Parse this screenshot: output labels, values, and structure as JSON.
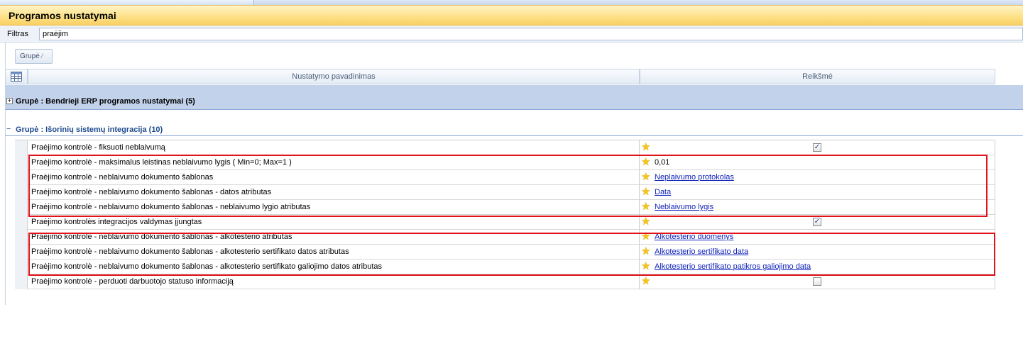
{
  "window": {
    "title": "Programos nustatymai"
  },
  "filter": {
    "label": "Filtras",
    "value": "praėjim"
  },
  "grouping": {
    "button_label": "Grupė",
    "sort_glyph": "⁄"
  },
  "grid": {
    "columns": {
      "name": "Nustatymo pavadinimas",
      "value": "Reikšmė"
    },
    "groups": [
      {
        "expander": "+",
        "label": "Grupė : Bendrieji ERP programos nustatymai (5)",
        "expanded": false
      },
      {
        "expander": "−",
        "label": "Grupė : Išorinių sistemų integracija (10)",
        "expanded": true
      }
    ],
    "rows": [
      {
        "name": "Praėjimo kontrolė - fiksuoti neblaivumą",
        "value_type": "checkbox",
        "checked": "✓"
      },
      {
        "name": "Praėjimo kontrolė - maksimalus leistinas neblaivumo lygis ( Min=0; Max=1 )",
        "value_type": "text",
        "value": "0,01"
      },
      {
        "name": "Praėjimo kontrolė - neblaivumo dokumento šablonas",
        "value_type": "link",
        "value": "Neplaivumo protokolas"
      },
      {
        "name": "Praėjimo kontrolė - neblaivumo dokumento šablonas - datos atributas",
        "value_type": "link",
        "value": "Data"
      },
      {
        "name": "Praėjimo kontrolė - neblaivumo dokumento šablonas - neblaivumo lygio atributas",
        "value_type": "link",
        "value": "Neblaivumo lygis"
      },
      {
        "name": "Praėjimo kontrolės integracijos valdymas įjungtas",
        "value_type": "checkbox",
        "checked": "✓"
      },
      {
        "name": "Praėjimo kontrolė - neblaivumo dokumento šablonas - alkotesterio atributas",
        "value_type": "link",
        "value": "Alkotesterio duomenys"
      },
      {
        "name": "Praėjimo kontrolė - neblaivumo dokumento šablonas - alkotesterio sertifikato datos atributas",
        "value_type": "link",
        "value": "Alkotesterio sertifikato data"
      },
      {
        "name": "Praėjimo kontrolė - neblaivumo dokumento šablonas - alkotesterio sertifikato galiojimo datos atributas",
        "value_type": "link",
        "value": "Alkotesterio sertifikato patikros galiojimo data"
      },
      {
        "name": "Praėjimo kontrolė - perduoti darbuotojo statuso informaciją",
        "value_type": "checkbox",
        "checked": ""
      }
    ]
  },
  "icons": {
    "star": "★",
    "column_chooser": "▦"
  },
  "colors": {
    "highlight_box": "#e0131b",
    "title_bar": "#fde28a",
    "group_header": "#c2d2eb",
    "link": "#0b1fb8"
  }
}
